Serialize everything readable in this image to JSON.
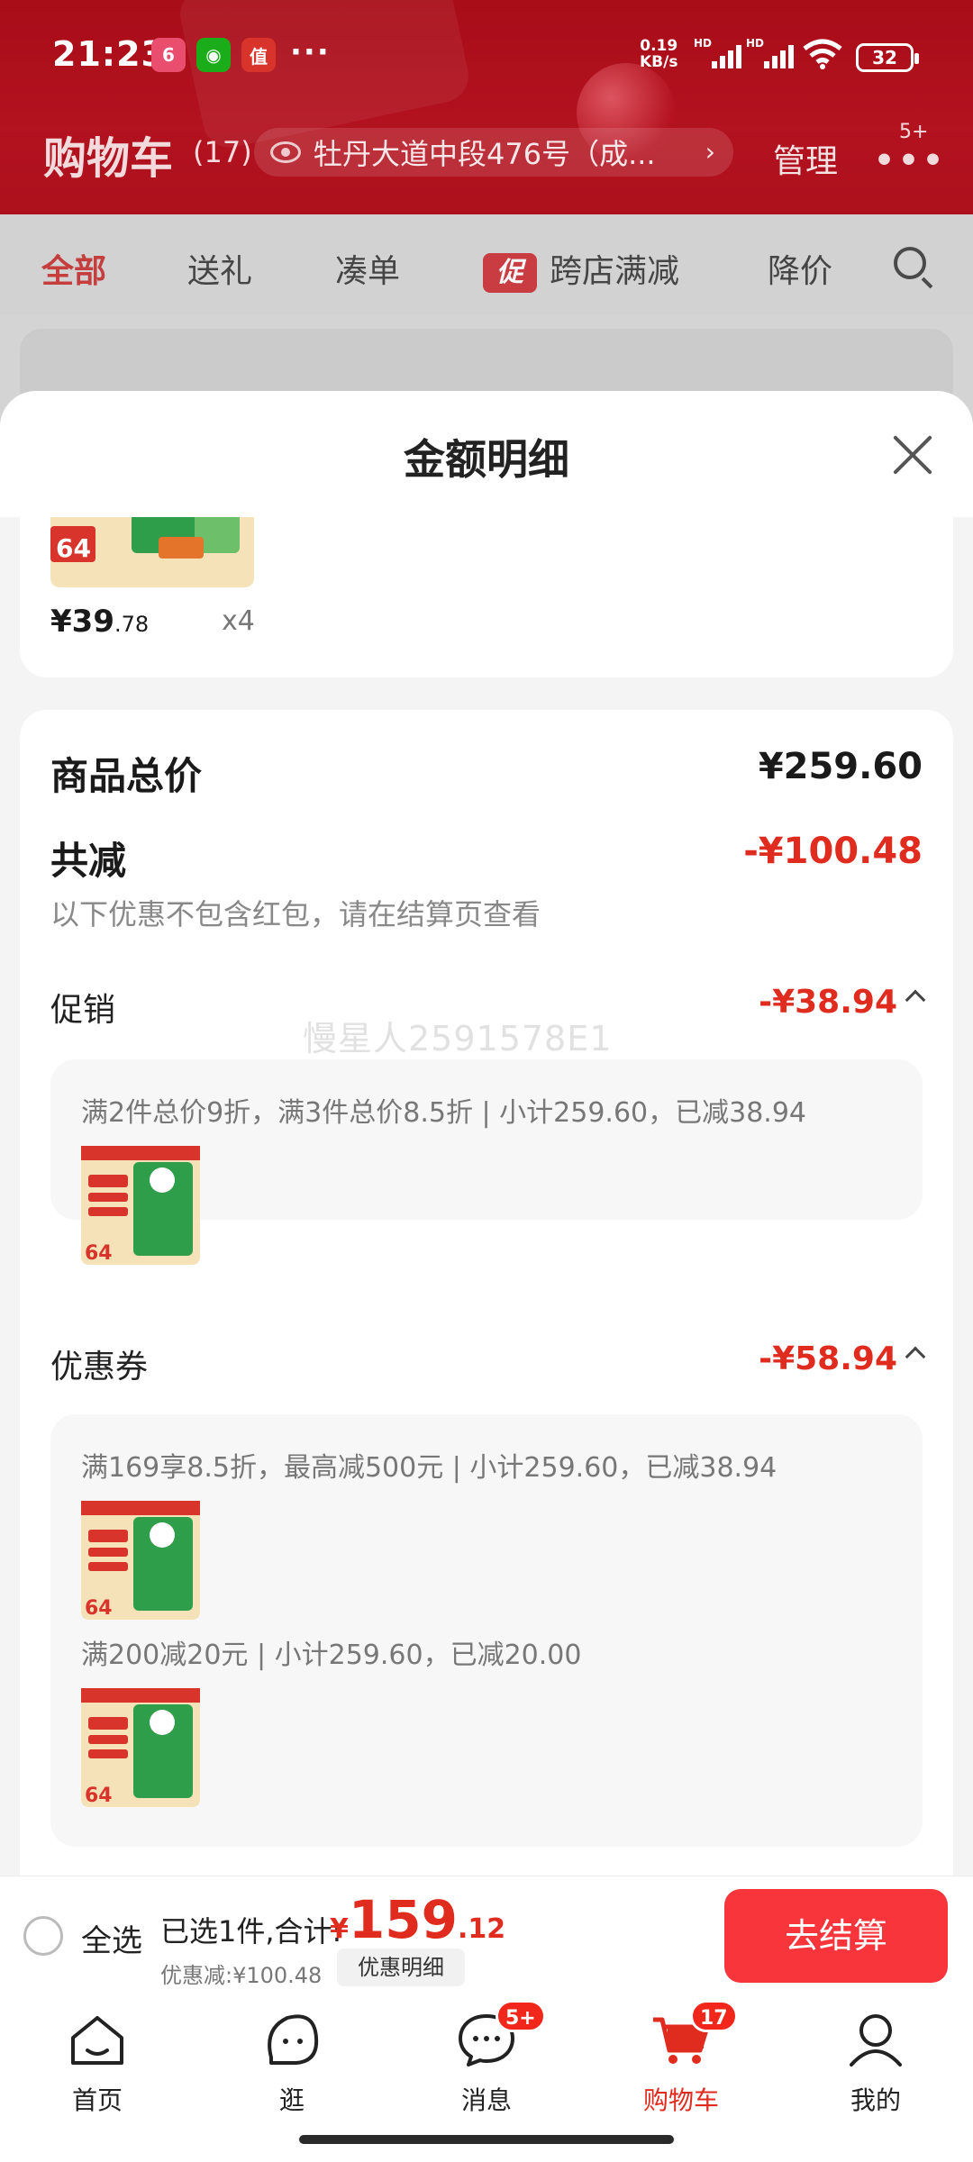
{
  "status_bar": {
    "time": "21:23",
    "net_speed_top": "0.19",
    "net_speed_unit": "KB/s",
    "battery": "32",
    "more_dots": "···"
  },
  "header": {
    "title": "购物车",
    "count": "(17)",
    "address": "牡丹大道中段476号（成...",
    "manage_label": "管理",
    "more_badge": "5+"
  },
  "tabs": [
    {
      "label": "全部",
      "active": true
    },
    {
      "label": "送礼"
    },
    {
      "label": "凑单"
    },
    {
      "badge": "促",
      "label": "跨店满减"
    },
    {
      "label": "降价"
    }
  ],
  "sheet": {
    "title": "金额明细",
    "item": {
      "price_prefix": "¥39",
      "price_decimal": ".78",
      "quantity": "x4"
    },
    "total_label": "商品总价",
    "total_value": "¥259.60",
    "reduce_label": "共减",
    "reduce_value": "-¥100.48",
    "reduce_note": "以下优惠不包含红包，请在结算页查看",
    "promo": {
      "label": "促销",
      "value": "-¥38.94",
      "desc": "满2件总价9折，满3件总价8.5折 | 小计259.60，已减38.94"
    },
    "coupon": {
      "label": "优惠券",
      "value": "-¥58.94",
      "desc1": "满169享8.5折，最高减500元 | 小计259.60，已减38.94",
      "desc2": "满200减20元 | 小计259.60，已减20.00"
    },
    "watermark": "慢星人2591578E1"
  },
  "checkout": {
    "select_all": "全选",
    "selected_text": "已选1件,合计:",
    "currency": "¥",
    "total_int": "159",
    "total_dec": ".12",
    "discount_text": "优惠减:¥100.48",
    "detail_button": "优惠明细",
    "checkout_button": "去结算"
  },
  "nav": [
    {
      "label": "首页",
      "icon": "home-icon"
    },
    {
      "label": "逛",
      "icon": "stroll-icon"
    },
    {
      "label": "消息",
      "icon": "message-icon",
      "badge": "5+"
    },
    {
      "label": "购物车",
      "icon": "cart-icon",
      "badge": "17",
      "active": true
    },
    {
      "label": "我的",
      "icon": "profile-icon"
    }
  ],
  "colors": {
    "brand_red": "#e02b1f",
    "header_red": "#b3121f",
    "checkout_button": "#f7353b"
  }
}
